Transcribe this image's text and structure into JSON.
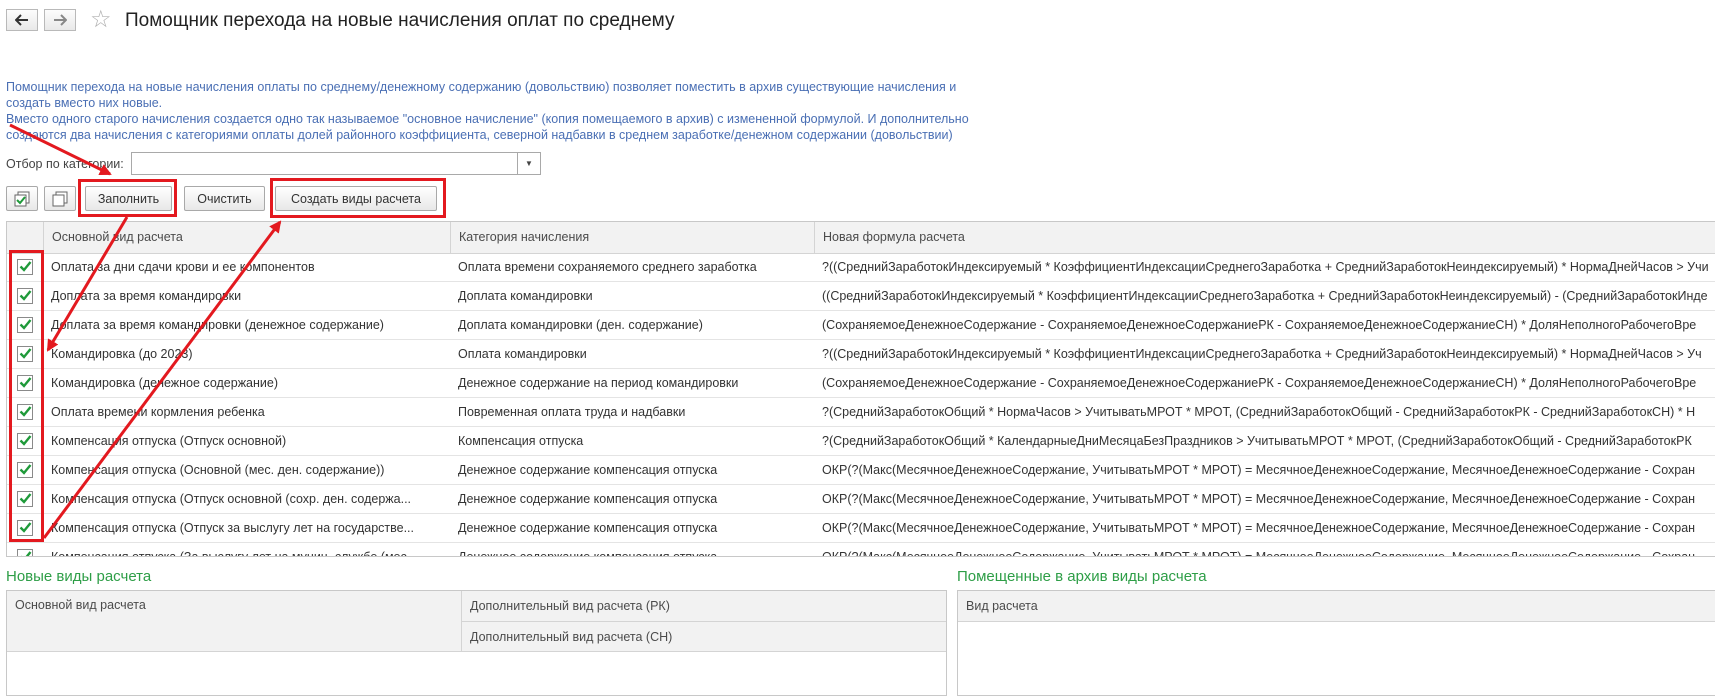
{
  "window": {
    "title": "Помощник перехода на новые начисления оплат по среднему"
  },
  "description": {
    "line1": "Помощник перехода на новые начисления оплаты по среднему/денежному содержанию (довольствию) позволяет поместить в архив существующие начисления и",
    "line2": "создать вместо них новые.",
    "line3": "Вместо одного старого начисления создается одно так называемое \"основное начисление\" (копия помещаемого в архив) с измененной формулой. И дополнительно",
    "line4": "создаются два начисления с категориями оплаты долей районного коэффициента, северной надбавки в среднем заработке/денежном содержании (довольствии)"
  },
  "filter": {
    "label": "Отбор по категории:",
    "value": ""
  },
  "toolbar": {
    "fill": "Заполнить",
    "clear": "Очистить",
    "create": "Создать виды расчета"
  },
  "table": {
    "columns": [
      "Основной вид расчета",
      "Категория начисления",
      "Новая формула расчета"
    ],
    "rows": [
      {
        "checked": true,
        "name": "Оплата за дни сдачи крови и ее компонентов",
        "category": "Оплата времени сохраняемого среднего заработка",
        "formula": "?((СреднийЗаработокИндексируемый * КоэффициентИндексацииСреднегоЗаработка + СреднийЗаработокНеиндексируемый) * НормаДнейЧасов > Учи"
      },
      {
        "checked": true,
        "name": "Доплата за время командировки",
        "category": "Доплата командировки",
        "formula": "((СреднийЗаработокИндексируемый * КоэффициентИндексацииСреднегоЗаработка + СреднийЗаработокНеиндексируемый) - (СреднийЗаработокИнде"
      },
      {
        "checked": true,
        "name": "Доплата за время командировки (денежное содержание)",
        "category": "Доплата командировки (ден. содержание)",
        "formula": "(СохраняемоеДенежноеСодержание - СохраняемоеДенежноеСодержаниеРК - СохраняемоеДенежноеСодержаниеСН) * ДоляНеполногоРабочегоВре"
      },
      {
        "checked": true,
        "name": "Командировка (до 2023)",
        "category": "Оплата командировки",
        "formula": "?((СреднийЗаработокИндексируемый * КоэффициентИндексацииСреднегоЗаработка + СреднийЗаработокНеиндексируемый) * НормаДнейЧасов > Уч"
      },
      {
        "checked": true,
        "name": "Командировка (денежное содержание)",
        "category": "Денежное содержание на период командировки",
        "formula": "(СохраняемоеДенежноеСодержание - СохраняемоеДенежноеСодержаниеРК - СохраняемоеДенежноеСодержаниеСН) * ДоляНеполногоРабочегоВре"
      },
      {
        "checked": true,
        "name": "Оплата времени кормления ребенка",
        "category": "Повременная оплата труда и надбавки",
        "formula": "?(СреднийЗаработокОбщий * НормаЧасов > УчитыватьМРОТ * МРОТ, (СреднийЗаработокОбщий - СреднийЗаработокРК - СреднийЗаработокСН) * Н"
      },
      {
        "checked": true,
        "name": "Компенсация отпуска (Отпуск основной)",
        "category": "Компенсация отпуска",
        "formula": "?(СреднийЗаработокОбщий * КалендарныеДниМесяцаБезПраздников > УчитыватьМРОТ * МРОТ, (СреднийЗаработокОбщий - СреднийЗаработокРК"
      },
      {
        "checked": true,
        "name": "Компенсация отпуска (Основной (мес. ден. содержание))",
        "category": "Денежное содержание компенсация отпуска",
        "formula": "ОКР(?(Макс(МесячноеДенежноеСодержание, УчитыватьМРОТ * МРОТ) = МесячноеДенежноеСодержание, МесячноеДенежноеСодержание - Сохран"
      },
      {
        "checked": true,
        "name": "Компенсация отпуска (Отпуск основной (сохр. ден. содержа...",
        "category": "Денежное содержание компенсация отпуска",
        "formula": "ОКР(?(Макс(МесячноеДенежноеСодержание, УчитыватьМРОТ * МРОТ) = МесячноеДенежноеСодержание, МесячноеДенежноеСодержание - Сохран"
      },
      {
        "checked": true,
        "name": "Компенсация отпуска (Отпуск за выслугу лет на государстве...",
        "category": "Денежное содержание компенсация отпуска",
        "formula": "ОКР(?(Макс(МесячноеДенежноеСодержание, УчитыватьМРОТ * МРОТ) = МесячноеДенежноеСодержание, МесячноеДенежноеСодержание - Сохран"
      },
      {
        "checked": true,
        "name": "Компенсация отпуска (За выслугу лет на муниц. службе (мес...",
        "category": "Денежное содержание компенсация отпуска",
        "formula": "ОКР(?(Макс(МесячноеДенежноеСодержание, УчитыватьМРОТ * МРОТ) = МесячноеДенежноеСодержание, МесячноеДенежноеСодержание - Сохран"
      }
    ]
  },
  "new_section": {
    "title": "Новые виды расчета",
    "col_main": "Основной вид расчета",
    "col_rk": "Дополнительный вид расчета (РК)",
    "col_sn": "Дополнительный вид расчета (СН)"
  },
  "archive_section": {
    "title": "Помещенные в архив виды расчета",
    "col": "Вид расчета"
  },
  "colors": {
    "accent_green": "#2e9e47",
    "description_blue": "#4a6fb4",
    "annotation_red": "#e3191f"
  }
}
